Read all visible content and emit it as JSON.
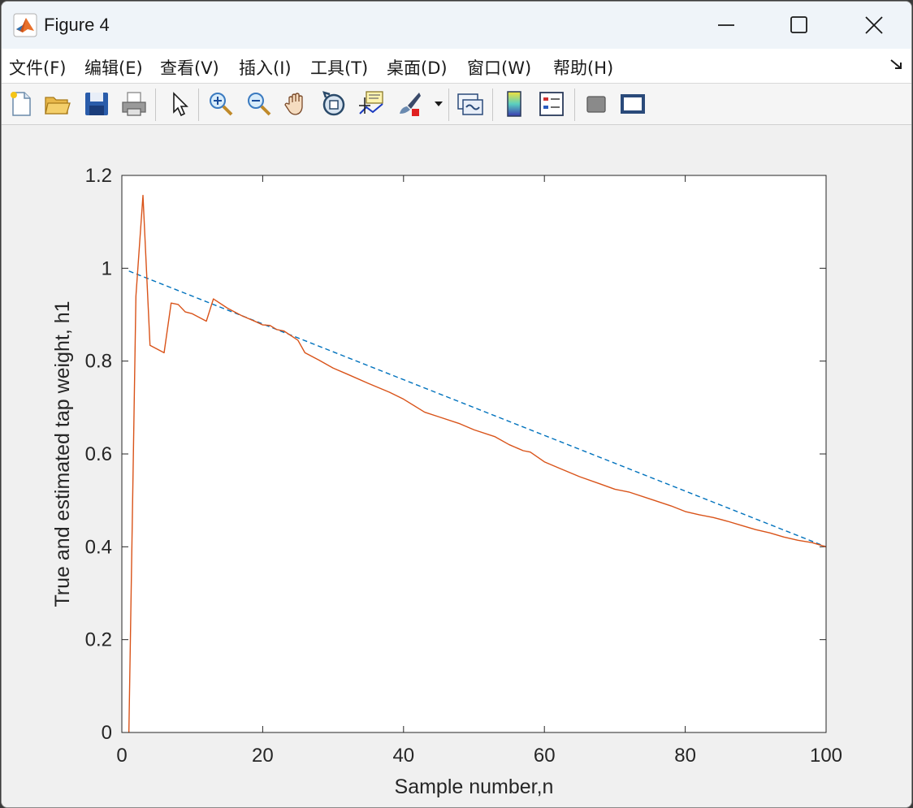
{
  "window": {
    "title": "Figure 4"
  },
  "menu": {
    "items": [
      "文件(F)",
      "编辑(E)",
      "查看(V)",
      "插入(I)",
      "工具(T)",
      "桌面(D)",
      "窗口(W)",
      "帮助(H)"
    ]
  },
  "toolbar": {
    "icons": [
      "new-figure-icon",
      "open-file-icon",
      "save-icon",
      "print-icon",
      "pointer-icon",
      "zoom-in-icon",
      "zoom-out-icon",
      "pan-hand-icon",
      "rotate-3d-icon",
      "data-cursor-icon",
      "brush-icon",
      "link-plot-icon",
      "colorbar-icon",
      "legend-icon",
      "hide-plot-tools-icon",
      "show-plot-tools-icon"
    ]
  },
  "colors": {
    "true_series": "#0072BD",
    "estimated_series": "#D95319"
  },
  "chart_data": {
    "type": "line",
    "xlabel": "Sample number,n",
    "ylabel": "True and estimated tap weight, h1",
    "xlim": [
      0,
      100
    ],
    "ylim": [
      0,
      1.2
    ],
    "xticks": [
      0,
      20,
      40,
      60,
      80,
      100
    ],
    "yticks": [
      0,
      0.2,
      0.4,
      0.6,
      0.8,
      1,
      1.2
    ],
    "xtick_labels": [
      "0",
      "20",
      "40",
      "60",
      "80",
      "100"
    ],
    "ytick_labels": [
      "0",
      "0.2",
      "0.4",
      "0.6",
      "0.8",
      "1",
      "1.2"
    ],
    "grid": false,
    "legend": "none",
    "series": [
      {
        "style": "dashed",
        "x": [
          1,
          100
        ],
        "y": [
          0.994,
          0.4
        ]
      },
      {
        "style": "solid",
        "x": [
          1,
          2,
          3,
          4,
          6,
          7,
          8,
          9,
          10,
          12,
          13,
          15,
          17,
          19,
          20,
          21,
          22,
          23,
          25,
          26,
          28,
          30,
          32,
          35,
          38,
          40,
          43,
          45,
          48,
          50,
          53,
          55,
          57,
          58,
          60,
          62,
          65,
          68,
          70,
          72,
          75,
          78,
          80,
          82,
          84,
          86,
          88,
          90,
          92,
          94,
          96,
          98,
          100
        ],
        "y": [
          0,
          0.94,
          1.157,
          0.834,
          0.818,
          0.925,
          0.922,
          0.906,
          0.902,
          0.886,
          0.934,
          0.914,
          0.898,
          0.885,
          0.878,
          0.877,
          0.868,
          0.865,
          0.845,
          0.818,
          0.802,
          0.785,
          0.772,
          0.752,
          0.733,
          0.718,
          0.69,
          0.68,
          0.665,
          0.652,
          0.637,
          0.62,
          0.607,
          0.604,
          0.583,
          0.57,
          0.551,
          0.535,
          0.524,
          0.518,
          0.503,
          0.488,
          0.476,
          0.469,
          0.463,
          0.455,
          0.446,
          0.437,
          0.43,
          0.421,
          0.414,
          0.409,
          0.4
        ]
      }
    ]
  }
}
